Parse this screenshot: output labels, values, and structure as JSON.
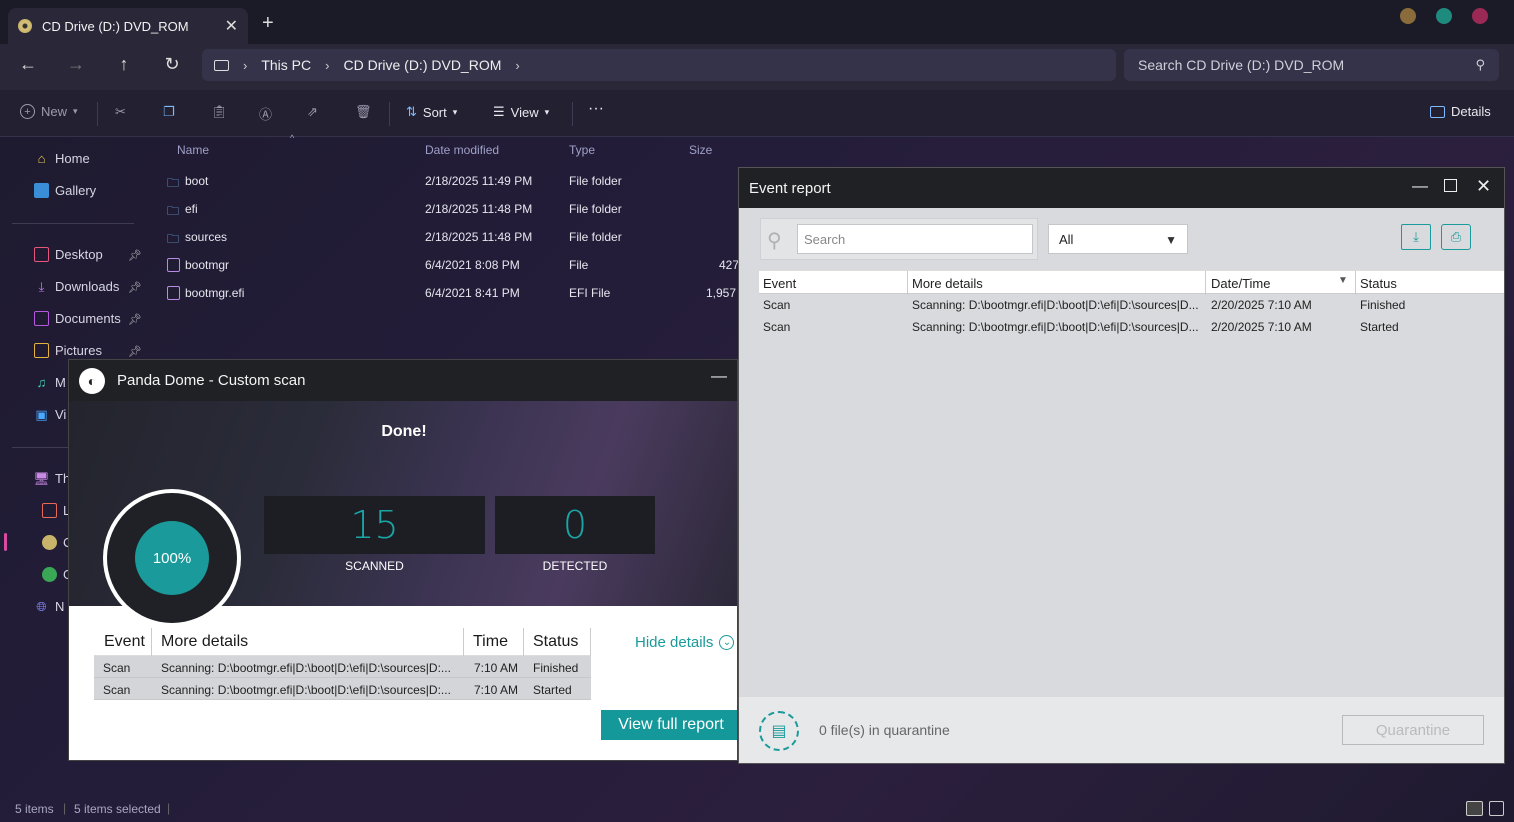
{
  "explorer": {
    "tab_title": "CD Drive (D:) DVD_ROM",
    "breadcrumb": [
      "This PC",
      "CD Drive (D:) DVD_ROM"
    ],
    "search_placeholder": "Search CD Drive (D:) DVD_ROM",
    "toolbar": {
      "new": "New",
      "sort": "Sort",
      "view": "View",
      "details": "Details"
    },
    "sidebar": {
      "home": "Home",
      "gallery": "Gallery",
      "desktop": "Desktop",
      "downloads": "Downloads",
      "documents": "Documents",
      "pictures": "Pictures",
      "music_partial": "M",
      "videos_partial": "Vi",
      "thispc_partial": "Th",
      "d1_partial": "L",
      "d2_partial": "C",
      "d3_partial": "G",
      "network_partial": "N"
    },
    "columns": [
      "Name",
      "Date modified",
      "Type",
      "Size"
    ],
    "files": [
      {
        "name": "boot",
        "date": "2/18/2025 11:49 PM",
        "type": "File folder",
        "size": ""
      },
      {
        "name": "efi",
        "date": "2/18/2025 11:48 PM",
        "type": "File folder",
        "size": ""
      },
      {
        "name": "sources",
        "date": "2/18/2025 11:48 PM",
        "type": "File folder",
        "size": ""
      },
      {
        "name": "bootmgr",
        "date": "6/4/2021 8:08 PM",
        "type": "File",
        "size": "427"
      },
      {
        "name": "bootmgr.efi",
        "date": "6/4/2021 8:41 PM",
        "type": "EFI File",
        "size": "1,957"
      }
    ],
    "status": {
      "items": "5 items",
      "selected": "5 items selected"
    }
  },
  "panda": {
    "title": "Panda Dome - Custom scan",
    "done": "Done!",
    "progress": "100%",
    "scanned_value": "15",
    "scanned_label": "SCANNED",
    "detected_value": "0",
    "detected_label": "DETECTED",
    "table_headers": [
      "Event",
      "More details",
      "Time",
      "Status"
    ],
    "rows": [
      {
        "event": "Scan",
        "details": "Scanning: D:\\bootmgr.efi|D:\\boot|D:\\efi|D:\\sources|D:...",
        "time": "7:10 AM",
        "status": "Finished"
      },
      {
        "event": "Scan",
        "details": "Scanning: D:\\bootmgr.efi|D:\\boot|D:\\efi|D:\\sources|D:...",
        "time": "7:10 AM",
        "status": "Started"
      }
    ],
    "hide_details": "Hide details",
    "view_full_report": "View full report"
  },
  "event_report": {
    "title": "Event report",
    "search_placeholder": "Search",
    "filter_value": "All",
    "table_headers": [
      "Event",
      "More details",
      "Date/Time",
      "Status"
    ],
    "rows": [
      {
        "event": "Scan",
        "details": "Scanning: D:\\bootmgr.efi|D:\\boot|D:\\efi|D:\\sources|D...",
        "datetime": "2/20/2025 7:10 AM",
        "status": "Finished"
      },
      {
        "event": "Scan",
        "details": "Scanning: D:\\bootmgr.efi|D:\\boot|D:\\efi|D:\\sources|D...",
        "datetime": "2/20/2025 7:10 AM",
        "status": "Started"
      }
    ],
    "quarantine_text": "0 file(s) in quarantine",
    "quarantine_button": "Quarantine"
  },
  "colors": {
    "accent": "#1a9a9a",
    "explorer_bg": "#2a2838"
  }
}
